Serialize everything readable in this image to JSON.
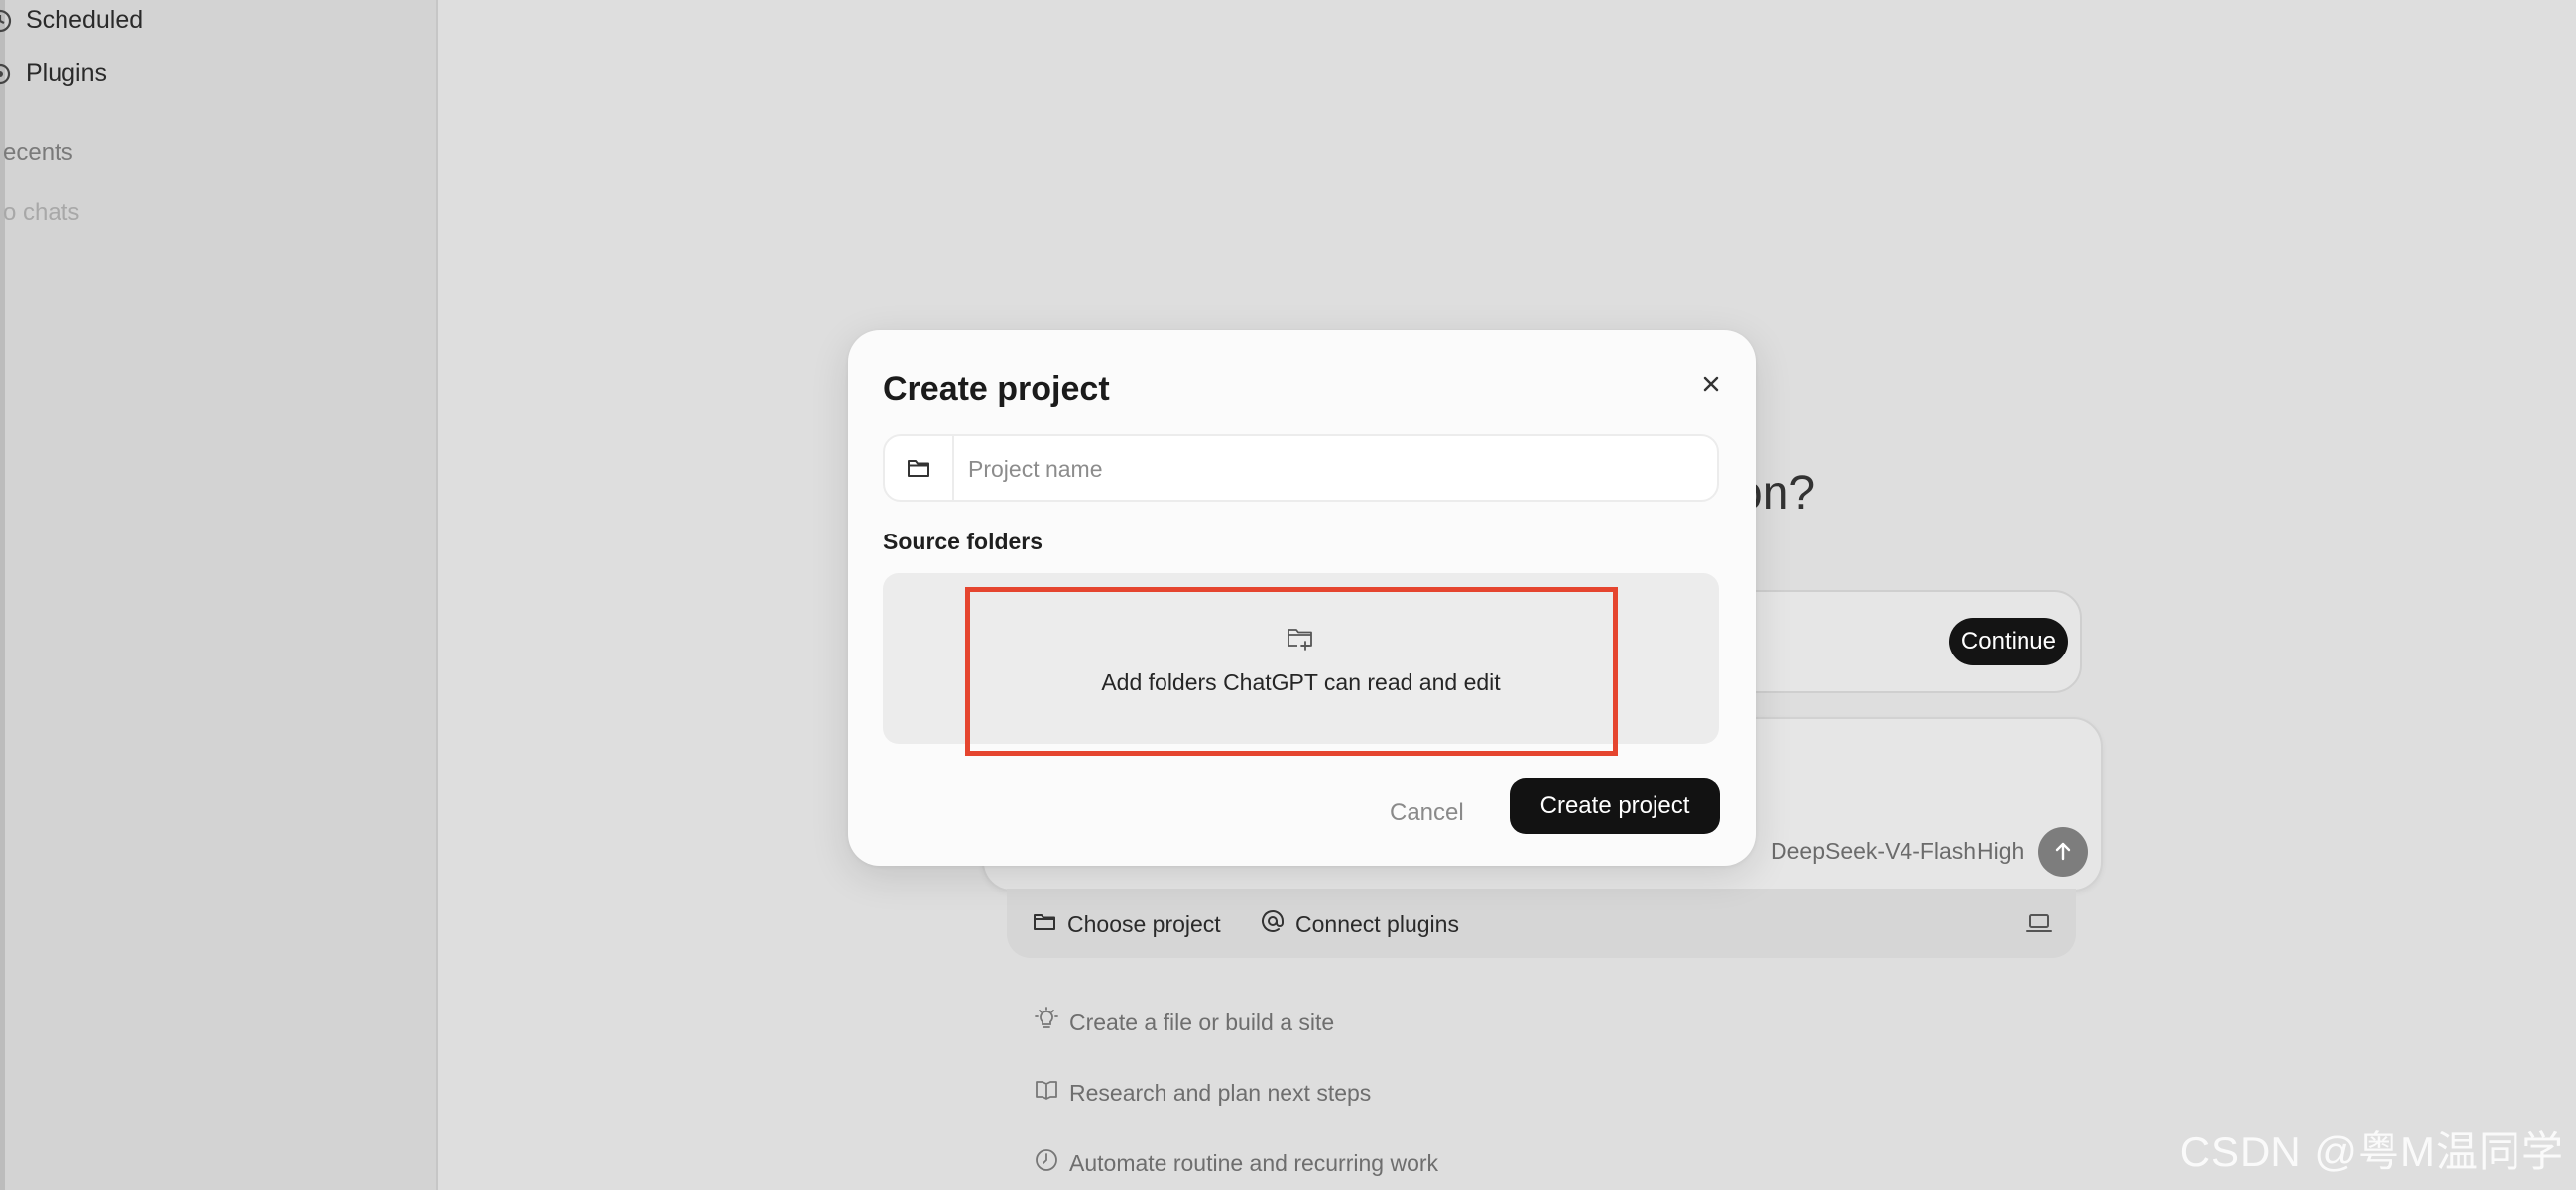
{
  "sidebar": {
    "items": [
      {
        "label": "Scheduled",
        "icon": "clock-icon"
      },
      {
        "label": "Plugins",
        "icon": "plugin-icon"
      }
    ],
    "recents_label": "ecents",
    "empty_label": "o chats"
  },
  "main": {
    "heading_tail": "on?",
    "continue_label": "Continue",
    "composer": {
      "model": "DeepSeek-V4-Flash",
      "effort": "High"
    },
    "project_bar": {
      "choose_project": "Choose project",
      "connect_plugins": "Connect plugins"
    },
    "suggestions": [
      {
        "label": "Create a file or build a site",
        "icon": "lightbulb-icon"
      },
      {
        "label": "Research and plan next steps",
        "icon": "book-icon"
      },
      {
        "label": "Automate routine and recurring work",
        "icon": "clock-icon"
      }
    ]
  },
  "modal": {
    "title": "Create project",
    "name_placeholder": "Project name",
    "name_value": "",
    "source_folders_label": "Source folders",
    "add_folders_text": "Add folders ChatGPT can read and edit",
    "cancel_label": "Cancel",
    "create_label": "Create project"
  },
  "colors": {
    "highlight": "#e5452f",
    "primary_button": "#121212",
    "backdrop": "#dedede"
  },
  "watermark": "CSDN @粤M温同学"
}
